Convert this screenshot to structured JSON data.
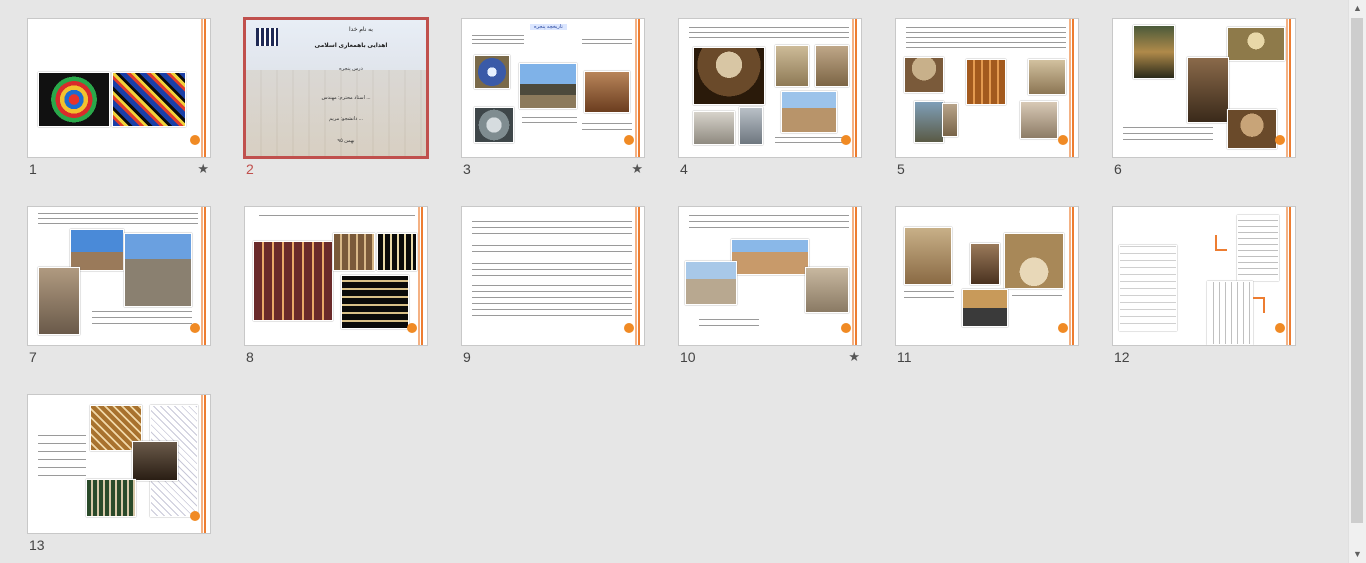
{
  "view": "slide-sorter",
  "colors": {
    "accent": "#ed7d31",
    "selection": "#c0504d",
    "background": "#e6e6e6"
  },
  "slides": [
    {
      "number": "1",
      "has_star": true,
      "selected": false,
      "layout": "stained-glass"
    },
    {
      "number": "2",
      "has_star": false,
      "selected": true,
      "layout": "title",
      "title_lines": [
        "به نام خدا",
        "اهدایی باهمعاری اسلامی",
        "درس پنجره",
        "استاد محترم: مهندس ...",
        "دانشجو: مریم ...",
        "بهمن ۹۵"
      ]
    },
    {
      "number": "3",
      "has_star": true,
      "selected": false,
      "layout": "text-images",
      "heading": "تاریخچه پنجره"
    },
    {
      "number": "4",
      "has_star": false,
      "selected": false,
      "layout": "images-grid"
    },
    {
      "number": "5",
      "has_star": false,
      "selected": false,
      "layout": "images-grid"
    },
    {
      "number": "6",
      "has_star": false,
      "selected": false,
      "layout": "images-right"
    },
    {
      "number": "7",
      "has_star": false,
      "selected": false,
      "layout": "persepolis"
    },
    {
      "number": "8",
      "has_star": false,
      "selected": false,
      "layout": "windows"
    },
    {
      "number": "9",
      "has_star": false,
      "selected": false,
      "layout": "text-only"
    },
    {
      "number": "10",
      "has_star": true,
      "selected": false,
      "layout": "buildings"
    },
    {
      "number": "11",
      "has_star": false,
      "selected": false,
      "layout": "images-grid"
    },
    {
      "number": "12",
      "has_star": false,
      "selected": false,
      "layout": "drawings"
    },
    {
      "number": "13",
      "has_star": false,
      "selected": false,
      "layout": "lattice"
    }
  ],
  "star_glyph": "★",
  "scrollbar": {
    "up": "▲",
    "down": "▼"
  }
}
